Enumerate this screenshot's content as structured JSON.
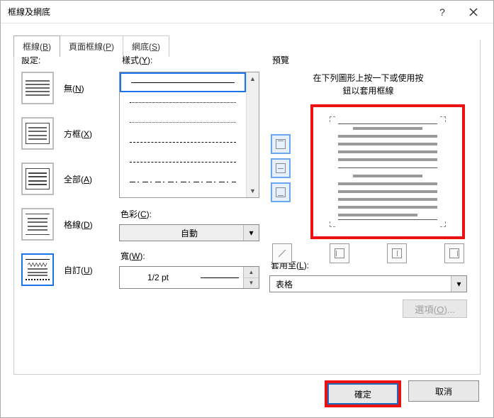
{
  "titlebar": {
    "title": "框線及網底"
  },
  "tabs": {
    "borders": "框線(B)",
    "page_borders": "頁面框線(P)",
    "shading": "網底(S)"
  },
  "settings": {
    "label": "設定:",
    "none": "無(N)",
    "box": "方框(X)",
    "all": "全部(A)",
    "grid": "格線(D)",
    "custom": "自訂(U)"
  },
  "style": {
    "label": "樣式(Y):",
    "color_label": "色彩(C):",
    "color_value": "自動",
    "width_label": "寬(W):",
    "width_value": "1/2 pt"
  },
  "preview": {
    "label": "預覽",
    "hint1": "在下列圖形上按一下或使用按",
    "hint2": "鈕以套用框線",
    "apply_label": "套用至(L):",
    "apply_value": "表格",
    "options": "選項(O)..."
  },
  "footer": {
    "ok": "確定",
    "cancel": "取消"
  }
}
